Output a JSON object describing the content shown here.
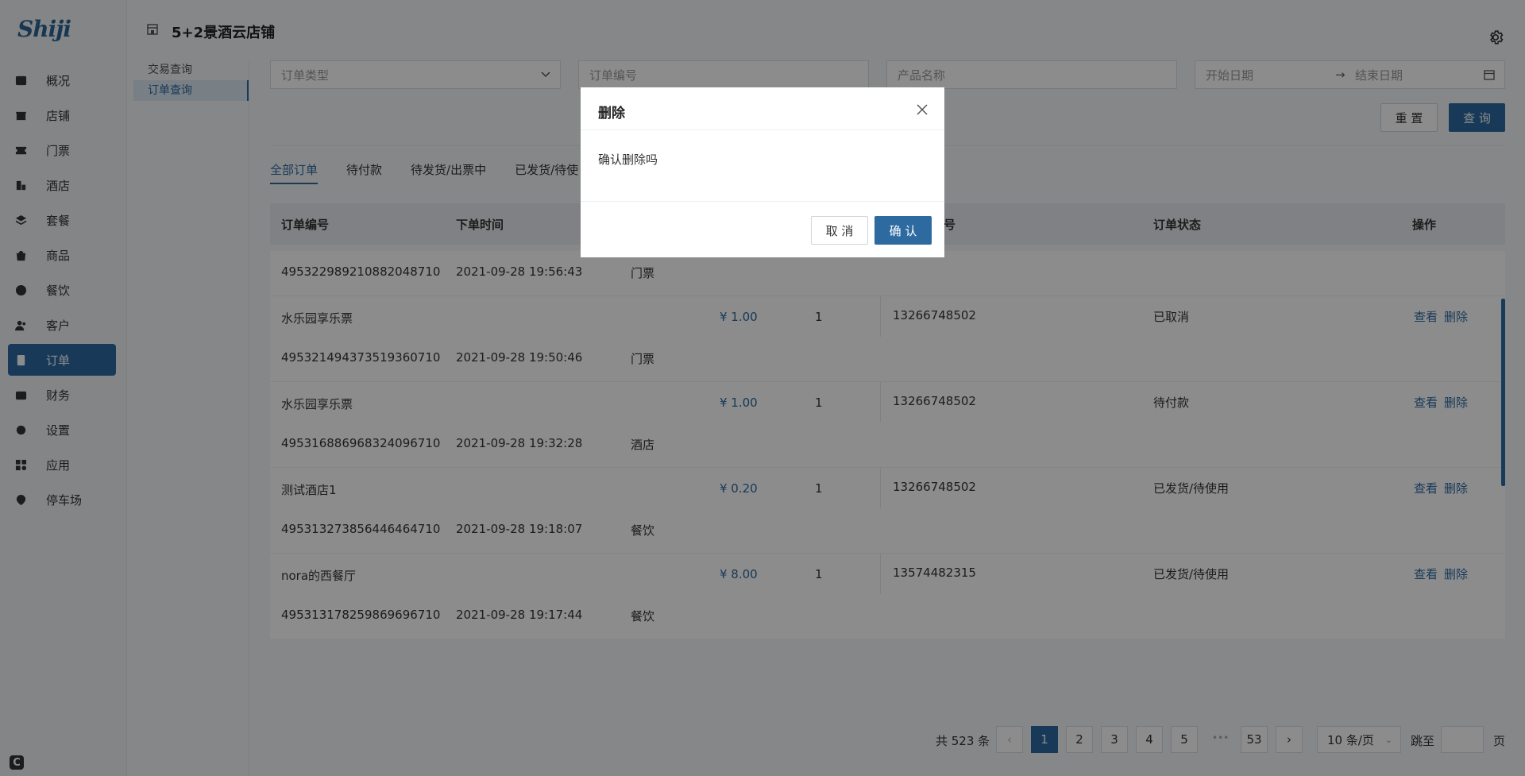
{
  "app": {
    "logo_text": "Shiji",
    "store_title": "5+2景酒云店铺",
    "corner_badge": "C"
  },
  "sidebar": {
    "items": [
      {
        "label": "概况",
        "icon": "chart-icon"
      },
      {
        "label": "店铺",
        "icon": "store-icon"
      },
      {
        "label": "门票",
        "icon": "ticket-icon"
      },
      {
        "label": "酒店",
        "icon": "hotel-icon"
      },
      {
        "label": "套餐",
        "icon": "layers-icon"
      },
      {
        "label": "商品",
        "icon": "bag-icon"
      },
      {
        "label": "餐饮",
        "icon": "dining-icon"
      },
      {
        "label": "客户",
        "icon": "users-icon"
      },
      {
        "label": "订单",
        "icon": "order-icon",
        "active": true
      },
      {
        "label": "财务",
        "icon": "wallet-icon"
      },
      {
        "label": "设置",
        "icon": "gear-icon"
      },
      {
        "label": "应用",
        "icon": "apps-icon"
      },
      {
        "label": "停车场",
        "icon": "parking-icon"
      }
    ]
  },
  "submenu": {
    "items": [
      "交易查询",
      "订单查询"
    ]
  },
  "filters": {
    "order_type": "订单类型",
    "order_no": "订单编号",
    "product_name": "产品名称",
    "start_date": "开始日期",
    "end_date": "结束日期",
    "reset": "重 置",
    "query": "查 询"
  },
  "tabs": [
    "全部订单",
    "待付款",
    "待发货/出票中",
    "已发货/待使"
  ],
  "table": {
    "headers": [
      "订单编号",
      "下单时间",
      "号",
      "订单状态",
      "操作"
    ],
    "view_label": "查看",
    "delete_label": "删除",
    "groups": [
      {
        "order_no": "495322989210882048710",
        "time": "2021-09-28 19:56:43",
        "type": "门票",
        "product": "水乐园享乐票",
        "price": "¥ 1.00",
        "qty": "1",
        "phone": "13266748502",
        "status": "已取消"
      },
      {
        "order_no": "495321494373519360710",
        "time": "2021-09-28 19:50:46",
        "type": "门票",
        "product": "水乐园享乐票",
        "price": "¥ 1.00",
        "qty": "1",
        "phone": "13266748502",
        "status": "待付款"
      },
      {
        "order_no": "495316886968324096710",
        "time": "2021-09-28 19:32:28",
        "type": "酒店",
        "product": "测试酒店1",
        "price": "¥ 0.20",
        "qty": "1",
        "phone": "13266748502",
        "status": "已发货/待使用"
      },
      {
        "order_no": "495313273856446464710",
        "time": "2021-09-28 19:18:07",
        "type": "餐饮",
        "product": "nora的西餐厅",
        "price": "¥ 8.00",
        "qty": "1",
        "phone": "13574482315",
        "status": "已发货/待使用"
      },
      {
        "order_no": "495313178259869696710",
        "time": "2021-09-28 19:17:44",
        "type": "餐饮"
      }
    ]
  },
  "pagination": {
    "total": "共 523 条",
    "pages": [
      "1",
      "2",
      "3",
      "4",
      "5"
    ],
    "ellipsis": "•••",
    "last": "53",
    "page_size": "10 条/页",
    "jump_label": "跳至",
    "page_suffix": "页"
  },
  "modal": {
    "title": "删除",
    "message": "确认删除吗",
    "cancel": "取 消",
    "ok": "确 认"
  },
  "colors": {
    "accent": "#2c6aa0"
  }
}
